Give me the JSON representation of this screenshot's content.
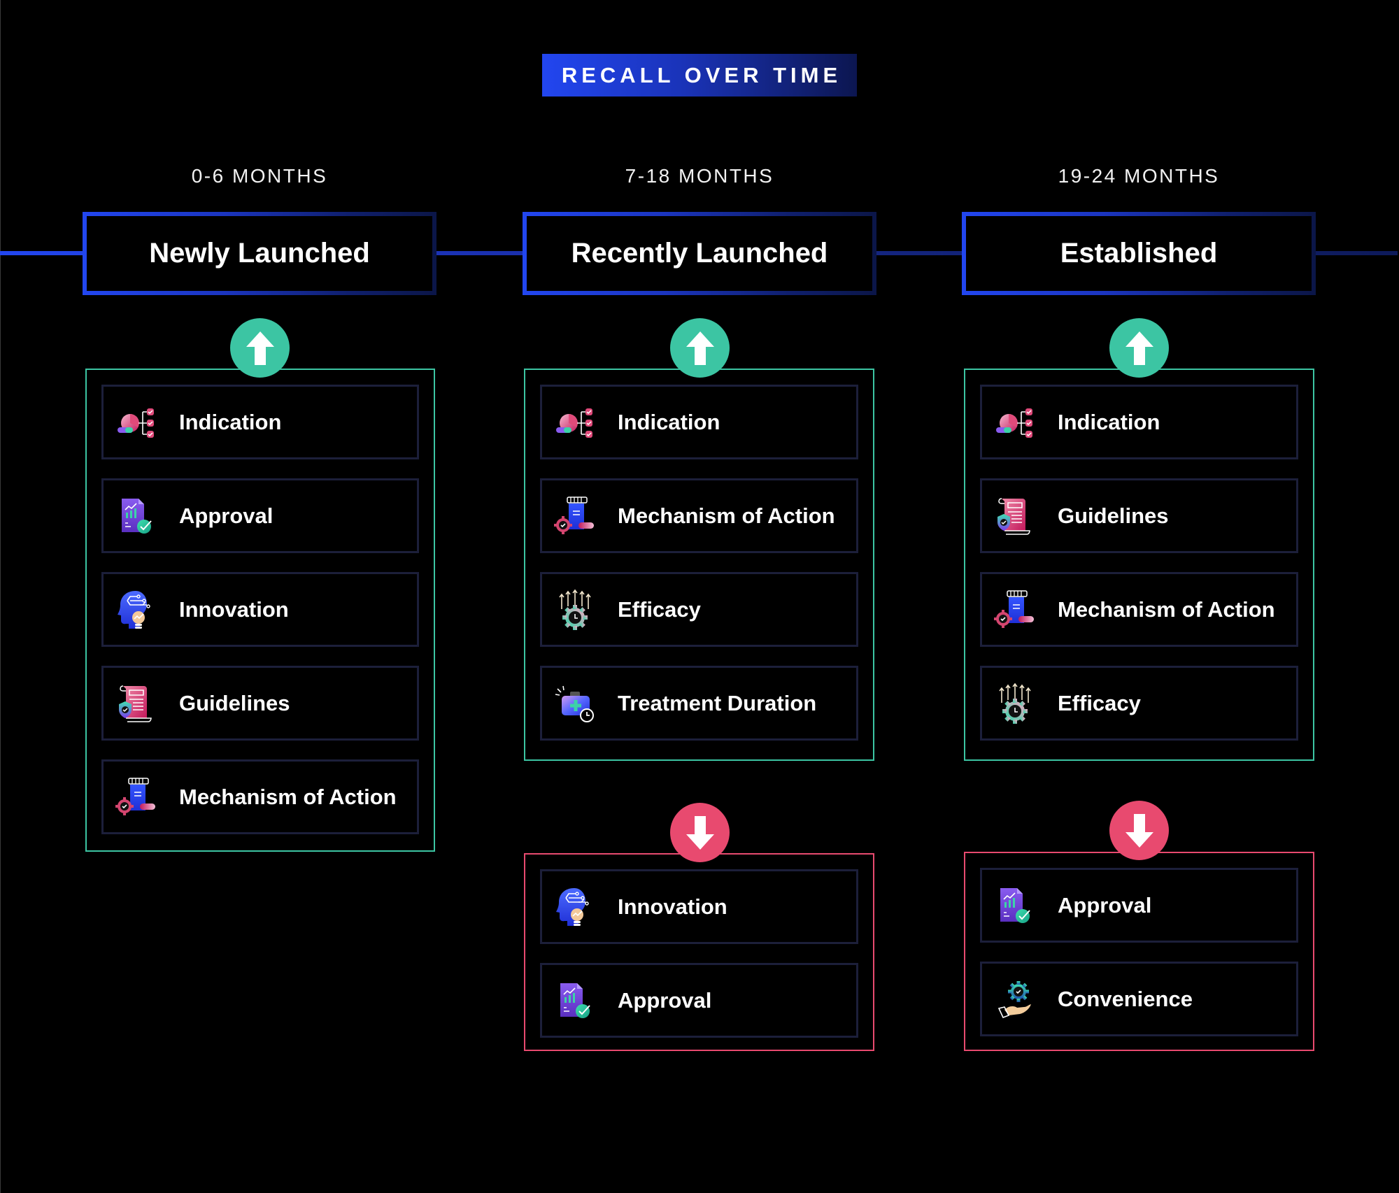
{
  "title": "RECALL OVER TIME",
  "colors": {
    "accent_blue": "#2246f0",
    "accent_navy": "#0c1650",
    "increase": "#3cc5a3",
    "decrease": "#e84a6f",
    "card_border": "#1c1f3a"
  },
  "columns": [
    {
      "period": "0-6 MONTHS",
      "stage": "Newly Launched",
      "increase": {
        "direction_icon": "arrow-up-icon",
        "items": [
          {
            "label": "Indication",
            "icon": "indication-icon"
          },
          {
            "label": "Approval",
            "icon": "approval-icon"
          },
          {
            "label": "Innovation",
            "icon": "innovation-icon"
          },
          {
            "label": "Guidelines",
            "icon": "guidelines-icon"
          },
          {
            "label": "Mechanism of Action",
            "icon": "mechanism-of-action-icon"
          }
        ]
      },
      "decrease": null
    },
    {
      "period": "7-18 MONTHS",
      "stage": "Recently Launched",
      "increase": {
        "direction_icon": "arrow-up-icon",
        "items": [
          {
            "label": "Indication",
            "icon": "indication-icon"
          },
          {
            "label": "Mechanism of Action",
            "icon": "mechanism-of-action-icon"
          },
          {
            "label": "Efficacy",
            "icon": "efficacy-icon"
          },
          {
            "label": "Treatment Duration",
            "icon": "treatment-duration-icon"
          }
        ]
      },
      "decrease": {
        "direction_icon": "arrow-down-icon",
        "items": [
          {
            "label": "Innovation",
            "icon": "innovation-icon"
          },
          {
            "label": "Approval",
            "icon": "approval-icon"
          }
        ]
      }
    },
    {
      "period": "19-24 MONTHS",
      "stage": "Established",
      "increase": {
        "direction_icon": "arrow-up-icon",
        "items": [
          {
            "label": "Indication",
            "icon": "indication-icon"
          },
          {
            "label": "Guidelines",
            "icon": "guidelines-icon"
          },
          {
            "label": "Mechanism of Action",
            "icon": "mechanism-of-action-icon"
          },
          {
            "label": "Efficacy",
            "icon": "efficacy-icon"
          }
        ]
      },
      "decrease": {
        "direction_icon": "arrow-down-icon",
        "items": [
          {
            "label": "Approval",
            "icon": "approval-icon"
          },
          {
            "label": "Convenience",
            "icon": "convenience-icon"
          }
        ]
      }
    }
  ]
}
